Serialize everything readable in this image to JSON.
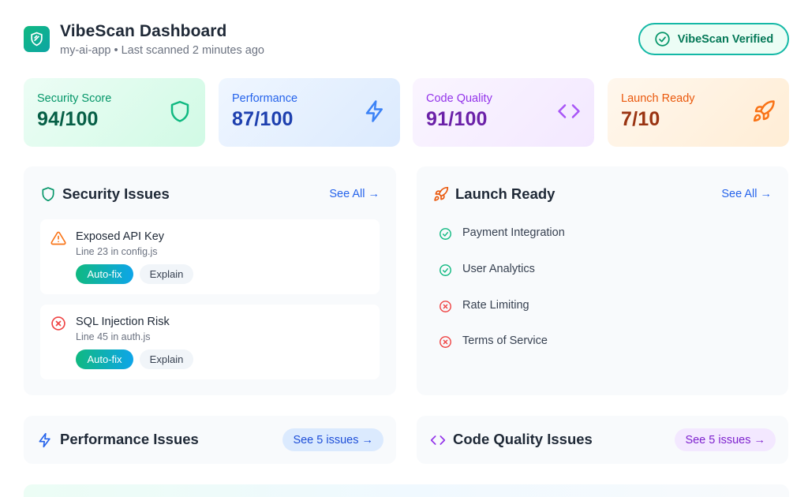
{
  "header": {
    "title": "VibeScan Dashboard",
    "subtitle": "my-ai-app • Last scanned 2 minutes ago",
    "verified_label": "VibeScan Verified"
  },
  "metrics": [
    {
      "label": "Security Score",
      "value": "94/100",
      "icon": "shield-icon",
      "color": "#059669"
    },
    {
      "label": "Performance",
      "value": "87/100",
      "icon": "lightning-icon",
      "color": "#2563eb"
    },
    {
      "label": "Code Quality",
      "value": "91/100",
      "icon": "code-icon",
      "color": "#9333ea"
    },
    {
      "label": "Launch Ready",
      "value": "7/10",
      "icon": "rocket-icon",
      "color": "#ea580c"
    }
  ],
  "security_panel": {
    "title": "Security Issues",
    "see_all": "See All →",
    "issues": [
      {
        "title": "Exposed API Key",
        "location": "Line 23 in config.js",
        "severity": "warning",
        "fix_label": "Auto-fix",
        "explain_label": "Explain"
      },
      {
        "title": "SQL Injection Risk",
        "location": "Line 45 in auth.js",
        "severity": "error",
        "fix_label": "Auto-fix",
        "explain_label": "Explain"
      }
    ]
  },
  "launch_panel": {
    "title": "Launch Ready",
    "see_all": "See All →",
    "items": [
      {
        "label": "Payment Integration",
        "status": "done"
      },
      {
        "label": "User Analytics",
        "status": "done"
      },
      {
        "label": "Rate Limiting",
        "status": "missing"
      },
      {
        "label": "Terms of Service",
        "status": "missing"
      }
    ]
  },
  "performance_bar": {
    "title": "Performance Issues",
    "link": "See 5 issues →"
  },
  "code_quality_bar": {
    "title": "Code Quality Issues",
    "link": "See 5 issues →"
  }
}
